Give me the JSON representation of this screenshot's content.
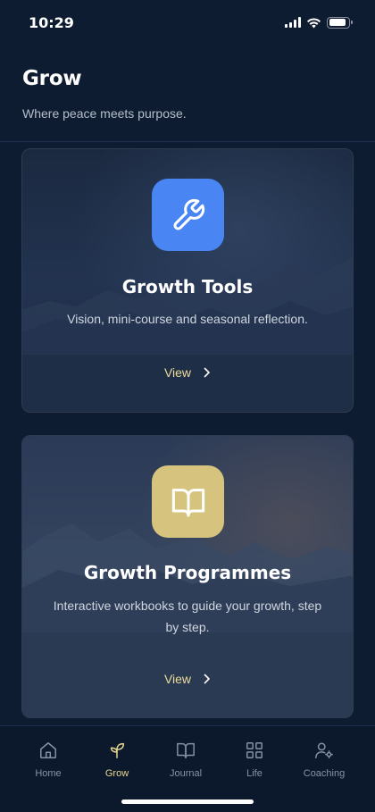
{
  "status_bar": {
    "time": "10:29",
    "battery_level": 0.9
  },
  "header": {
    "title": "Grow",
    "subtitle": "Where peace meets purpose."
  },
  "cards": [
    {
      "title": "Growth Tools",
      "description": "Vision, mini-course and seasonal reflection.",
      "action_label": "View",
      "icon": "wrench-icon",
      "icon_color": "#4a86f3"
    },
    {
      "title": "Growth Programmes",
      "description": "Interactive workbooks to guide your growth, step by step.",
      "action_label": "View",
      "icon": "open-book-icon",
      "icon_color": "#d6c37e"
    }
  ],
  "tab_bar": {
    "items": [
      {
        "label": "Home",
        "icon": "home-icon"
      },
      {
        "label": "Grow",
        "icon": "sprout-icon",
        "active": true
      },
      {
        "label": "Journal",
        "icon": "open-book-icon"
      },
      {
        "label": "Life",
        "icon": "grid-icon"
      },
      {
        "label": "Coaching",
        "icon": "user-settings-icon"
      }
    ]
  },
  "colors": {
    "background": "#0e1c31",
    "accent": "#e8d791",
    "tab_inactive": "#8593a6"
  }
}
